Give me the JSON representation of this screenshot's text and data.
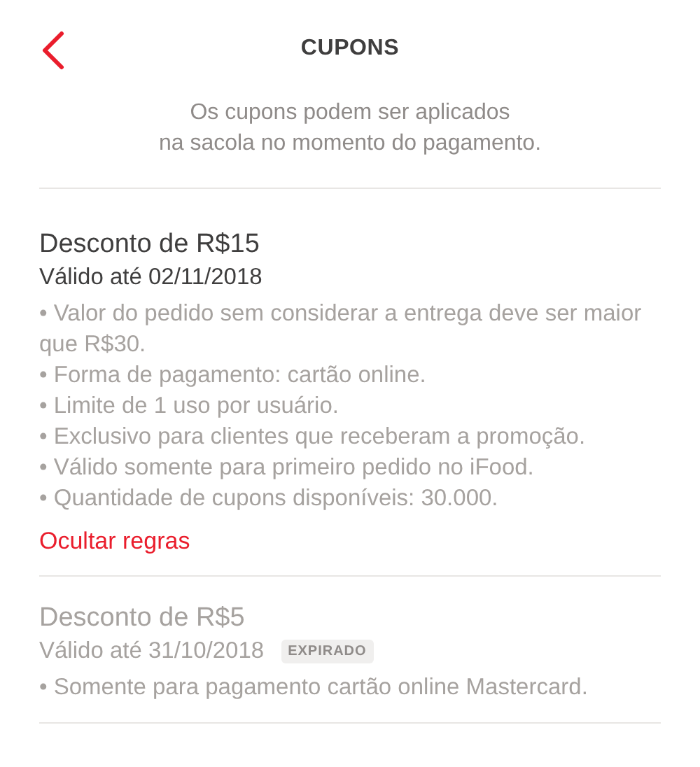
{
  "header": {
    "title": "CUPONS"
  },
  "intro_lines": [
    "Os cupons podem ser aplicados",
    "na sacola no momento do pagamento."
  ],
  "coupons": [
    {
      "title": "Desconto de R$15",
      "validity": "Válido até 02/11/2018",
      "expired": false,
      "rules": [
        "• Valor do pedido sem considerar a entrega deve ser maior que R$30.",
        "• Forma de pagamento: cartão online.",
        "• Limite de 1 uso por usuário.",
        "• Exclusivo para clientes que receberam a promoção.",
        "• Válido somente para primeiro pedido no iFood.",
        "• Quantidade de cupons disponíveis: 30.000."
      ],
      "toggle": "Ocultar regras"
    },
    {
      "title": "Desconto de R$5",
      "validity": "Válido até 31/10/2018",
      "expired": true,
      "badge": "EXPIRADO",
      "rules": [
        "• Somente para pagamento cartão online Mastercard."
      ]
    }
  ]
}
